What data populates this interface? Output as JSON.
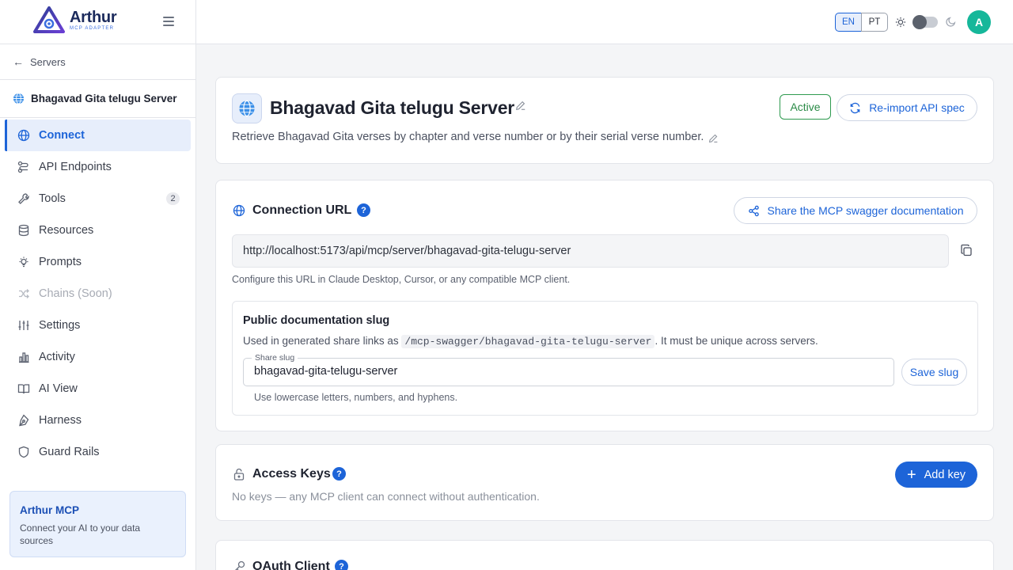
{
  "brand": {
    "name": "Arthur",
    "subtitle": "MCP ADAPTER"
  },
  "sidebar": {
    "back_label": "Servers",
    "server_name": "Bhagavad Gita telugu Server",
    "items": [
      {
        "label": "Connect",
        "icon": "globe-icon"
      },
      {
        "label": "API Endpoints",
        "icon": "endpoints-icon"
      },
      {
        "label": "Tools",
        "icon": "wrench-icon",
        "badge": "2"
      },
      {
        "label": "Resources",
        "icon": "database-icon"
      },
      {
        "label": "Prompts",
        "icon": "lightbulb-icon"
      },
      {
        "label": "Chains (Soon)",
        "icon": "shuffle-icon"
      },
      {
        "label": "Settings",
        "icon": "sliders-icon"
      },
      {
        "label": "Activity",
        "icon": "bar-chart-icon"
      },
      {
        "label": "AI View",
        "icon": "book-icon"
      },
      {
        "label": "Harness",
        "icon": "pen-tool-icon"
      },
      {
        "label": "Guard Rails",
        "icon": "shield-icon"
      }
    ],
    "promo": {
      "title": "Arthur MCP",
      "description": "Connect your AI to your data sources"
    }
  },
  "topbar": {
    "lang_en": "EN",
    "lang_pt": "PT",
    "avatar_initial": "A"
  },
  "server": {
    "title": "Bhagavad Gita telugu Server",
    "description": "Retrieve Bhagavad Gita verses by chapter and verse number or by their serial verse number.",
    "status": "Active",
    "reimport_label": "Re-import API spec"
  },
  "connection": {
    "title": "Connection URL",
    "share_label": "Share the MCP swagger documentation",
    "url": "http://localhost:5173/api/mcp/server/bhagavad-gita-telugu-server",
    "hint": "Configure this URL in Claude Desktop, Cursor, or any compatible MCP client.",
    "slug": {
      "title": "Public documentation slug",
      "desc_before": "Used in generated share links as",
      "desc_code": "/mcp-swagger/bhagavad-gita-telugu-server",
      "desc_after": ". It must be unique across servers.",
      "field_label": "Share slug",
      "value": "bhagavad-gita-telugu-server",
      "save_label": "Save slug",
      "hint": "Use lowercase letters, numbers, and hyphens."
    }
  },
  "access_keys": {
    "title": "Access Keys",
    "add_label": "Add key",
    "empty_hint": "No keys — any MCP client can connect without authentication."
  },
  "oauth": {
    "title": "OAuth Client"
  },
  "colors": {
    "accent": "#1d64d8",
    "active": "#2a8a46",
    "avatar": "#16b79a"
  }
}
